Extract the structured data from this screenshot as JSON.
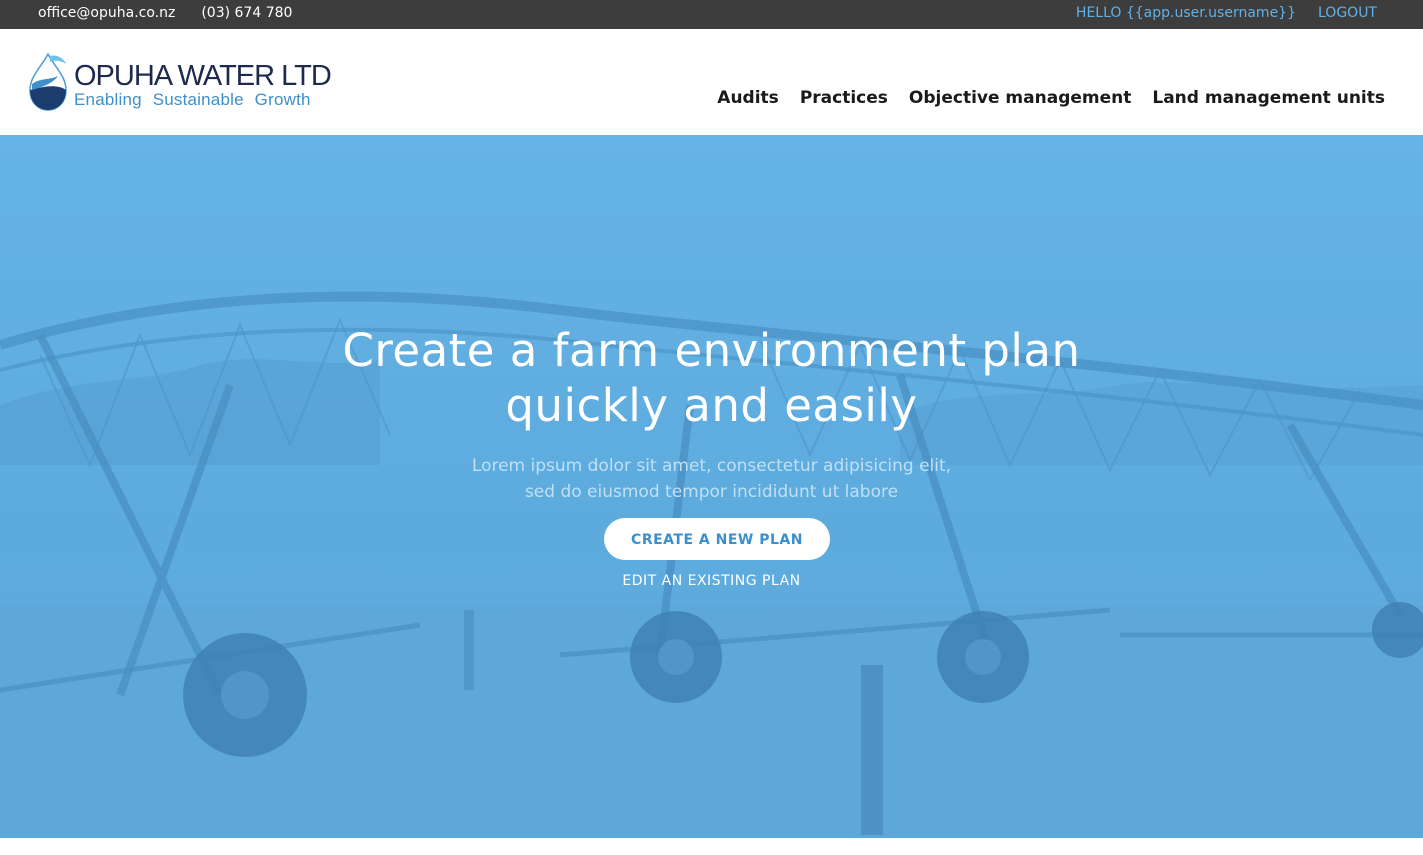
{
  "topbar": {
    "email": "office@opuha.co.nz",
    "phone": "(03) 674 780",
    "greeting": "HELLO {{app.user.username}}",
    "logout": "LOGOUT"
  },
  "brand": {
    "name": "OPUHA WATER LTD",
    "tagline": "Enabling Sustainable Growth"
  },
  "nav": {
    "items": [
      {
        "label": "Audits"
      },
      {
        "label": "Practices"
      },
      {
        "label": "Objective management"
      },
      {
        "label": "Land management units"
      }
    ]
  },
  "hero": {
    "title_line1": "Create a farm environment plan",
    "title_line2": "quickly and easily",
    "subtitle_line1": "Lorem ipsum dolor sit amet, consectetur adipisicing elit,",
    "subtitle_line2": "sed do eiusmod tempor incididunt ut labore",
    "primary_cta": "CREATE A NEW PLAN",
    "secondary_cta": "EDIT AN EXISTING PLAN"
  },
  "colors": {
    "topbar_bg": "#3d3d3d",
    "accent": "#62b1e6",
    "hero_overlay": "#64b1e3",
    "brand_navy": "#1d2a4e",
    "brand_blue": "#3f8fc9"
  },
  "icons": {
    "logo": "water-drop-logo-icon"
  }
}
